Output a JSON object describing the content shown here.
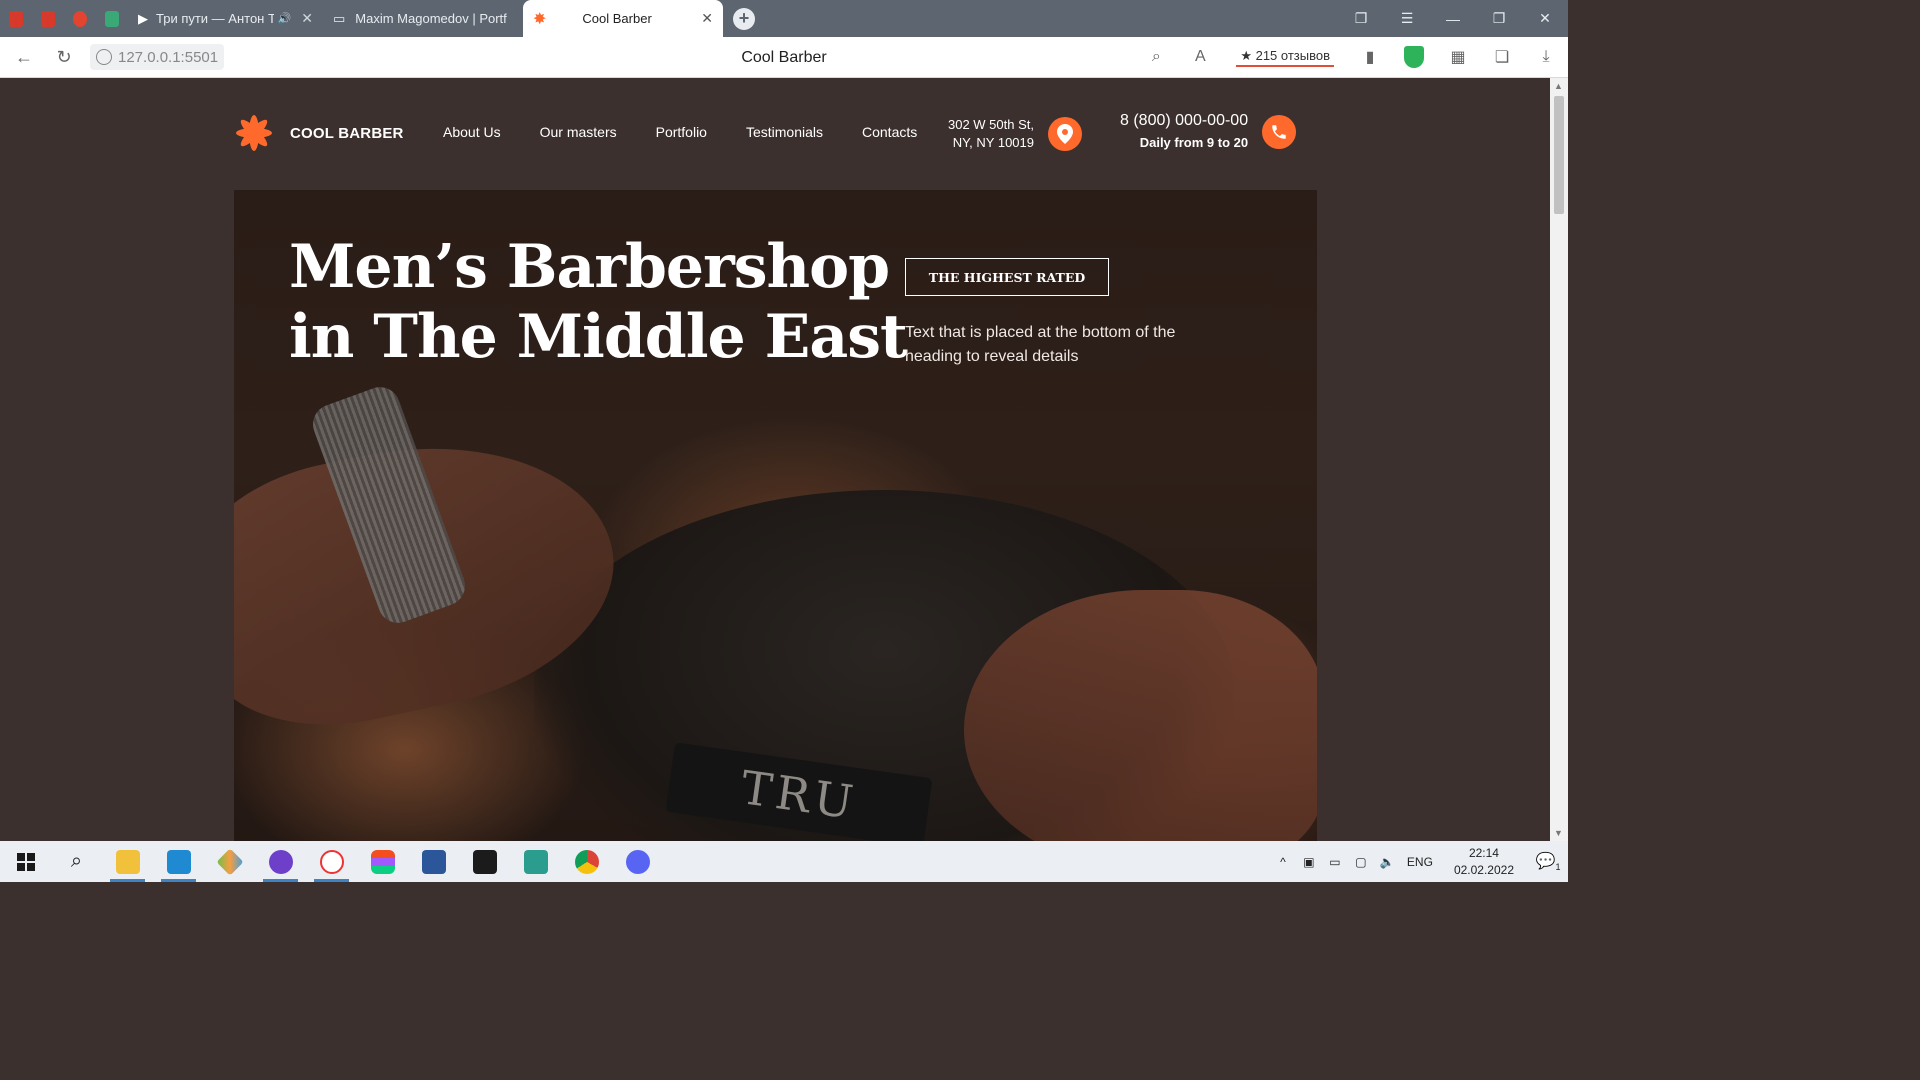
{
  "browser": {
    "tabs": [
      {
        "title": "Три пути — Антон Т",
        "audio": "🔊"
      },
      {
        "title": "Maxim Magomedov | Portf"
      },
      {
        "title": "Cool Barber",
        "active": true
      }
    ],
    "url": "127.0.0.1:5501",
    "page_title": "Cool Barber",
    "reviews": "★ 215 отзывов",
    "colors": {
      "tabbar": "#5d6670",
      "shield": "#2fb35a"
    }
  },
  "site": {
    "brand": "COOL BARBER",
    "nav": [
      "About Us",
      "Our masters",
      "Portfolio",
      "Testimonials",
      "Contacts"
    ],
    "address": {
      "line1": "302 W 50th St,",
      "line2": "NY, NY 10019"
    },
    "phone": {
      "number": "8 (800) 000-00-00",
      "hours": "Daily from 9 to 20"
    },
    "accent_color": "#ff6a2c",
    "hero": {
      "title_line1": "Men’s Barbershop",
      "title_line2": "in The Middle East",
      "badge": "THE HIGHEST RATED",
      "subtitle": "Text that is placed at the bottom of the heading to reveal details",
      "razor_text": "TRU"
    }
  },
  "taskbar": {
    "apps": [
      "windows-start",
      "search",
      "file-explorer",
      "vscode",
      "git-client",
      "github-desktop",
      "yandex-browser",
      "figma",
      "word",
      "terminal",
      "powershell",
      "chrome",
      "discord"
    ],
    "lang": "ENG",
    "time": "22:14",
    "date": "02.02.2022",
    "notifications": "1"
  }
}
